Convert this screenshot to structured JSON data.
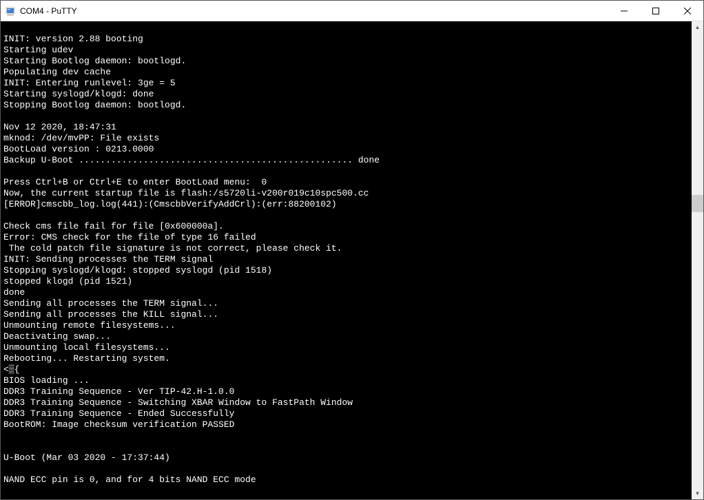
{
  "window": {
    "title": "COM4 - PuTTY"
  },
  "terminal": {
    "lines": [
      "",
      "INIT: version 2.88 booting",
      "Starting udev",
      "Starting Bootlog daemon: bootlogd.",
      "Populating dev cache",
      "INIT: Entering runlevel: 3ge = 5",
      "Starting syslogd/klogd: done",
      "Stopping Bootlog daemon: bootlogd.",
      "",
      "Nov 12 2020, 18:47:31",
      "mknod: /dev/mvPP: File exists",
      "BootLoad version : 0213.0000",
      "Backup U-Boot ................................................... done",
      "",
      "Press Ctrl+B or Ctrl+E to enter BootLoad menu:  0",
      "Now, the current startup file is flash:/s5720li-v200r019c10spc500.cc",
      "[ERROR]cmscbb_log.log(441):(CmscbbVerifyAddCrl):(err:88200102)",
      "",
      "Check cms file fail for file [0x600000a].",
      "Error: CMS check for the file of type 16 failed",
      " The cold patch file signature is not correct, please check it.",
      "INIT: Sending processes the TERM signal",
      "Stopping syslogd/klogd: stopped syslogd (pid 1518)",
      "stopped klogd (pid 1521)",
      "done",
      "Sending all processes the TERM signal...",
      "Sending all processes the KILL signal...",
      "Unmounting remote filesystems...",
      "Deactivating swap...",
      "Unmounting local filesystems...",
      "Rebooting... Restarting system.",
      "<▒{",
      "BIOS loading ...",
      "DDR3 Training Sequence - Ver TIP-42.H-1.0.0",
      "DDR3 Training Sequence - Switching XBAR Window to FastPath Window",
      "DDR3 Training Sequence - Ended Successfully",
      "BootROM: Image checksum verification PASSED",
      "",
      "",
      "U-Boot (Mar 03 2020 - 17:37:44)",
      "",
      "NAND ECC pin is 0, and for 4 bits NAND ECC mode"
    ]
  }
}
